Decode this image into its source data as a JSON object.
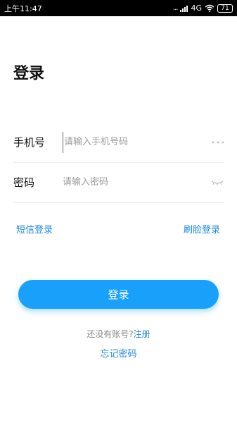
{
  "status_bar": {
    "time": "上午11:47",
    "dots": "...",
    "network": "4G",
    "battery": "71"
  },
  "page": {
    "title": "登录"
  },
  "form": {
    "phone": {
      "label": "手机号",
      "placeholder": "请输入手机号码",
      "value": ""
    },
    "password": {
      "label": "密码",
      "placeholder": "请输入密码",
      "value": ""
    }
  },
  "alt_login": {
    "sms_label": "短信登录",
    "face_label": "刷脸登录"
  },
  "login_button_label": "登录",
  "register": {
    "prompt": "还没有账号?",
    "link_label": "注册"
  },
  "forgot_password_label": "忘记密码",
  "colors": {
    "accent": "#19a0fb",
    "link": "#1a88e0",
    "status_bar_bg": "#000000"
  },
  "icons": {
    "phone_field_trailing": "more-dots-icon",
    "password_field_trailing": "eye-closed-icon"
  }
}
